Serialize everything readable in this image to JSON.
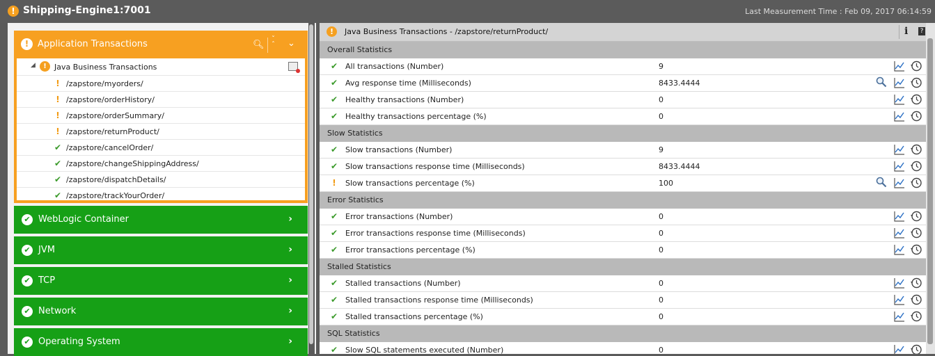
{
  "header": {
    "title": "Shipping-Engine1:7001",
    "status_icon": "warning-icon",
    "measurement_time": "Last Measurement Time : Feb 09, 2017 06:14:59",
    "colors": {
      "warning": "#f5a020",
      "ok": "#16a016",
      "header_bg": "#5b5b5b"
    }
  },
  "left": {
    "app_tx": {
      "label": "Application Transactions",
      "status": "warning",
      "tree_root": "Java Business Transactions",
      "items": [
        {
          "label": "/zapstore/myorders/",
          "status": "warn"
        },
        {
          "label": "/zapstore/orderHistory/",
          "status": "warn"
        },
        {
          "label": "/zapstore/orderSummary/",
          "status": "warn"
        },
        {
          "label": "/zapstore/returnProduct/",
          "status": "warn"
        },
        {
          "label": "/zapstore/cancelOrder/",
          "status": "ok"
        },
        {
          "label": "/zapstore/changeShippingAddress/",
          "status": "ok"
        },
        {
          "label": "/zapstore/dispatchDetails/",
          "status": "ok"
        },
        {
          "label": "/zapstore/trackYourOrder/",
          "status": "ok"
        }
      ]
    },
    "layers": [
      {
        "label": "WebLogic Container",
        "status": "ok"
      },
      {
        "label": "JVM",
        "status": "ok"
      },
      {
        "label": "TCP",
        "status": "ok"
      },
      {
        "label": "Network",
        "status": "ok"
      },
      {
        "label": "Operating System",
        "status": "ok"
      }
    ]
  },
  "right": {
    "title": "Java Business Transactions - /zapstore/returnProduct/",
    "info_label": "i",
    "help_label": "?",
    "sections": [
      {
        "title": "Overall Statistics",
        "rows": [
          {
            "name": "All transactions (Number)",
            "value": "9",
            "status": "ok",
            "drill": false
          },
          {
            "name": "Avg response time (Milliseconds)",
            "value": "8433.4444",
            "status": "ok",
            "drill": true
          },
          {
            "name": "Healthy transactions (Number)",
            "value": "0",
            "status": "ok",
            "drill": false
          },
          {
            "name": "Healthy transactions percentage (%)",
            "value": "0",
            "status": "ok",
            "drill": false
          }
        ]
      },
      {
        "title": "Slow Statistics",
        "rows": [
          {
            "name": "Slow transactions (Number)",
            "value": "9",
            "status": "ok",
            "drill": false
          },
          {
            "name": "Slow transactions response time (Milliseconds)",
            "value": "8433.4444",
            "status": "ok",
            "drill": false
          },
          {
            "name": "Slow transactions percentage (%)",
            "value": "100",
            "status": "warn",
            "drill": true
          }
        ]
      },
      {
        "title": "Error Statistics",
        "rows": [
          {
            "name": "Error transactions (Number)",
            "value": "0",
            "status": "ok",
            "drill": false
          },
          {
            "name": "Error transactions response time (Milliseconds)",
            "value": "0",
            "status": "ok",
            "drill": false
          },
          {
            "name": "Error transactions percentage (%)",
            "value": "0",
            "status": "ok",
            "drill": false
          }
        ]
      },
      {
        "title": "Stalled Statistics",
        "rows": [
          {
            "name": "Stalled transactions (Number)",
            "value": "0",
            "status": "ok",
            "drill": false
          },
          {
            "name": "Stalled transactions response time (Milliseconds)",
            "value": "0",
            "status": "ok",
            "drill": false
          },
          {
            "name": "Stalled transactions percentage (%)",
            "value": "0",
            "status": "ok",
            "drill": false
          }
        ]
      },
      {
        "title": "SQL Statistics",
        "rows": [
          {
            "name": "Slow SQL statements executed (Number)",
            "value": "0",
            "status": "ok",
            "drill": false
          }
        ]
      }
    ]
  }
}
